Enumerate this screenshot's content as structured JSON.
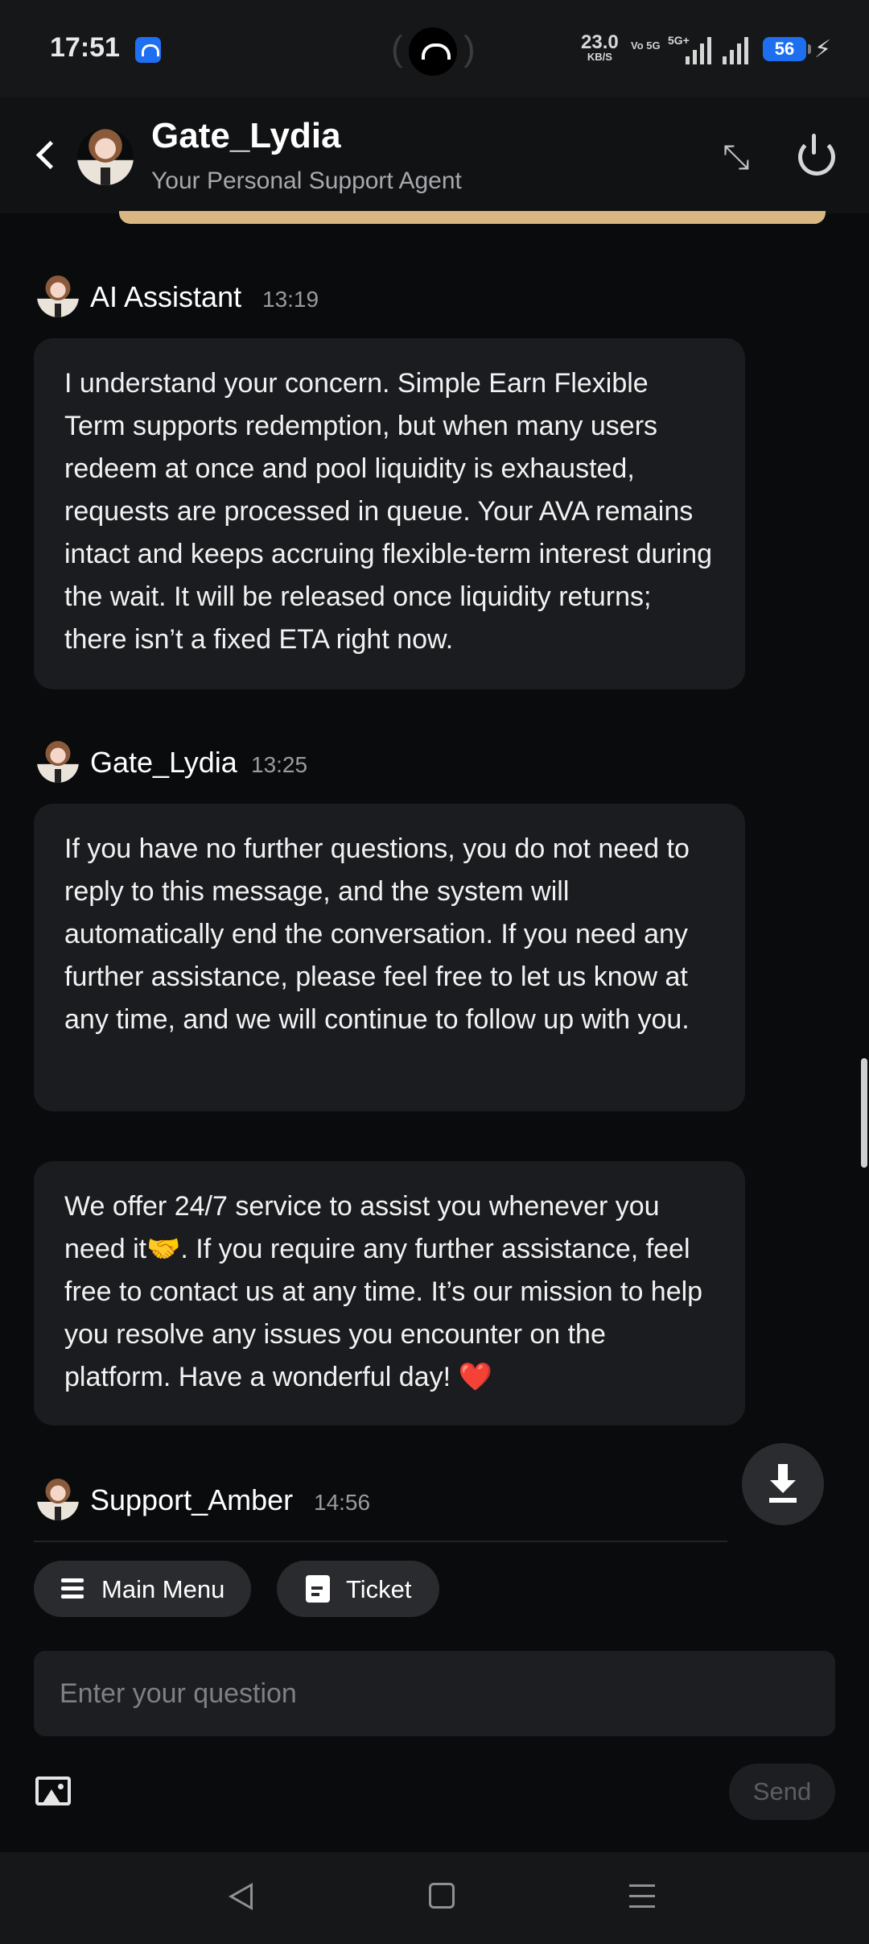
{
  "status_bar": {
    "time": "17:51",
    "net_speed": "23.0",
    "net_unit": "KB/S",
    "vo_label": "Vo 5G",
    "signal_label": "5G+",
    "battery": "56"
  },
  "header": {
    "title": "Gate_Lydia",
    "subtitle": "Your Personal Support Agent"
  },
  "messages": [
    {
      "sender": "AI Assistant",
      "time": "13:19",
      "text": "I understand your concern. Simple Earn Flexible Term supports redemption, but when many users redeem at once and pool liquidity is exhausted, requests are processed in queue. Your AVA remains intact and keeps accruing flexible-term interest during the wait. It will be released once liquidity returns; there isn’t a fixed ETA right now."
    },
    {
      "sender": "Gate_Lydia",
      "time": "13:25",
      "text": "If you have no further questions, you do not need to reply to this message, and the system will automatically end the conversation. If you need any further assistance, please feel free to let us know at any time, and we will continue to follow up with you."
    },
    {
      "text": "We offer 24/7 service to assist you whenever you need it🤝.  If you require any further assistance, feel free to contact us at any time. It’s our mission to help you resolve any issues you encounter on the platform. Have a wonderful day!  ❤️"
    },
    {
      "sender": "Support_Amber",
      "time": "14:56"
    }
  ],
  "quick_actions": {
    "main_menu": "Main Menu",
    "ticket": "Ticket"
  },
  "composer": {
    "placeholder": "Enter your question",
    "send_label": "Send"
  },
  "colors": {
    "background": "#0a0b0d",
    "bubble": "#1b1c1f",
    "accent_gold": "#d9b783",
    "status_blue": "#1d6ff0"
  },
  "icons": [
    "back-icon",
    "collapse-icon",
    "power-icon",
    "download-icon",
    "menu-icon",
    "document-icon",
    "image-icon",
    "nav-back-icon",
    "nav-home-icon",
    "nav-menu-icon"
  ]
}
